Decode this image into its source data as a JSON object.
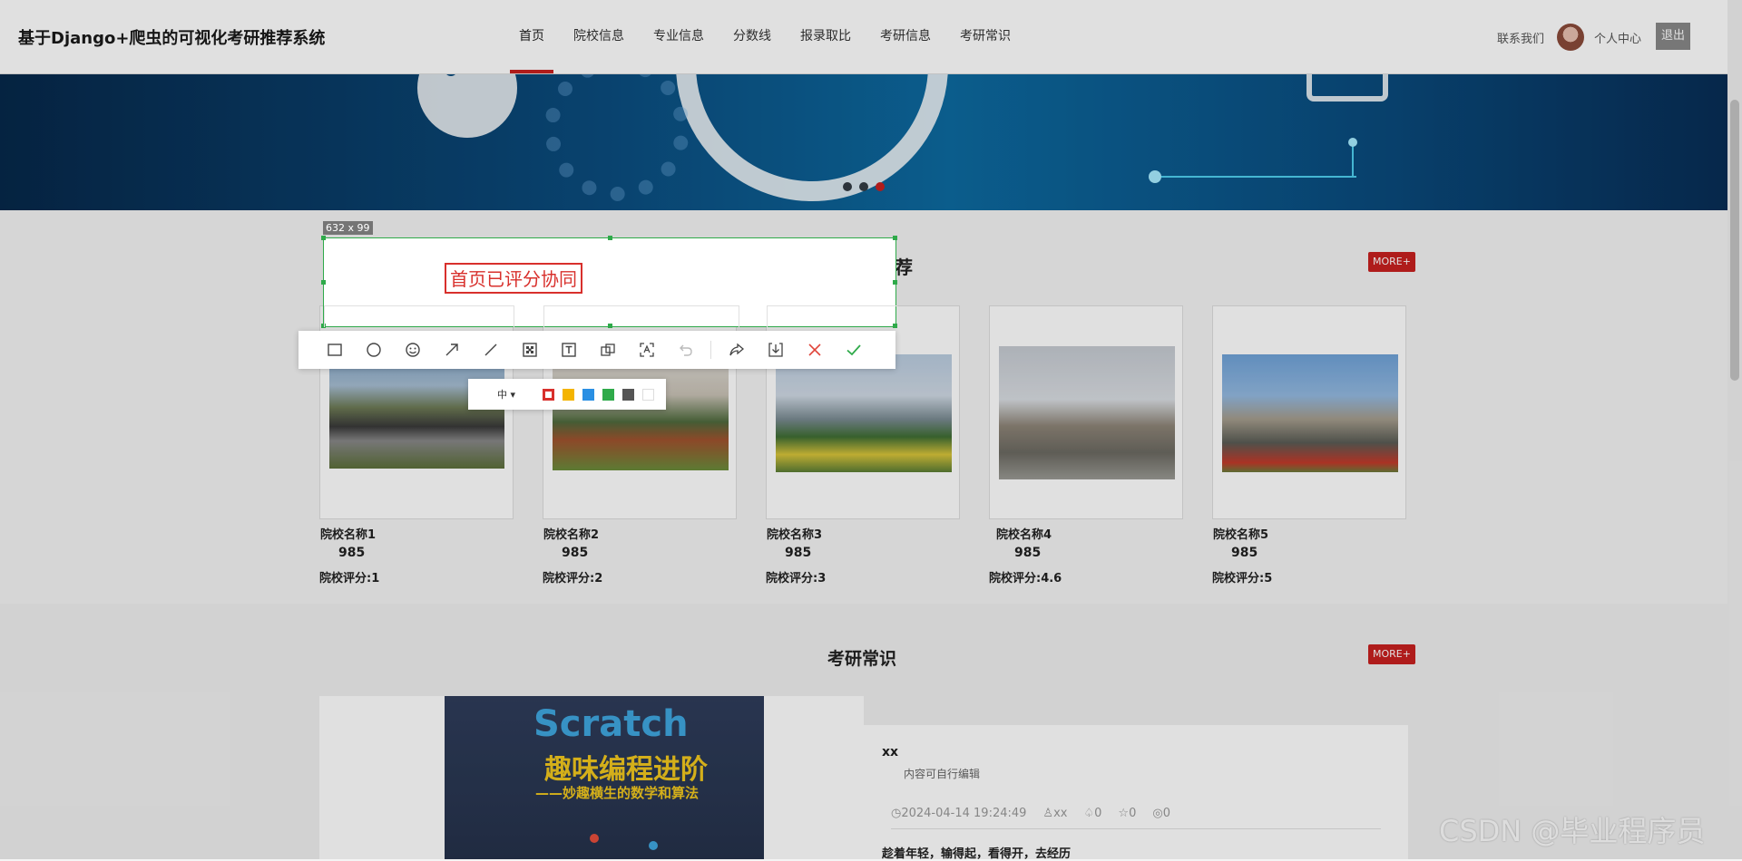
{
  "header": {
    "brand": "基于Django+爬虫的可视化考研推荐系统",
    "nav": [
      "首页",
      "院校信息",
      "专业信息",
      "分数线",
      "报录取比",
      "考研信息",
      "考研常识"
    ],
    "contact": "联系我们",
    "user_center": "个人中心",
    "logout": "退出"
  },
  "banner": {
    "active_slide_index": 2,
    "slide_count": 3
  },
  "colors": {
    "accent": "#c8201f",
    "selection_border": "#2faa4a",
    "annotation_red": "#d8302c"
  },
  "capture": {
    "size_label": "632 x 99",
    "annotation_text": "首页已评分协同",
    "size_option": "中",
    "swatches": [
      "#d8302c",
      "#f4b400",
      "#2a8fe3",
      "#2faa4a",
      "#555555",
      "#ffffff"
    ],
    "tools": [
      "rectangle-icon",
      "ellipse-icon",
      "emoji-icon",
      "arrow-icon",
      "line-icon",
      "mosaic-icon",
      "text-icon",
      "copy-icon",
      "ocr-icon",
      "undo-icon",
      "share-icon",
      "save-icon",
      "close-icon",
      "confirm-icon"
    ]
  },
  "schools": {
    "title": "院校信息推荐",
    "more": "MORE+",
    "items": [
      {
        "name": "院校名称1",
        "level": "985",
        "score": "院校评分:1"
      },
      {
        "name": "院校名称2",
        "level": "985",
        "score": "院校评分:2"
      },
      {
        "name": "院校名称3",
        "level": "985",
        "score": "院校评分:3"
      },
      {
        "name": "院校名称4",
        "level": "985",
        "score": "院校评分:4.6"
      },
      {
        "name": "院校名称5",
        "level": "985",
        "score": "院校评分:5"
      }
    ]
  },
  "knowledge": {
    "title": "考研常识",
    "more": "MORE+",
    "book_title": "Scratch",
    "book_subtitle": "趣味编程进阶",
    "book_tagline": "——妙趣横生的数学和算法",
    "news": {
      "title": "xx",
      "desc": "内容可自行编辑",
      "date": "2024-04-14 19:24:49",
      "author": "xx",
      "likes": "0",
      "favorites": "0",
      "views": "0",
      "subtitle": "趁着年轻，输得起，看得开，去经历"
    }
  },
  "watermark": "CSDN @毕业程序员"
}
